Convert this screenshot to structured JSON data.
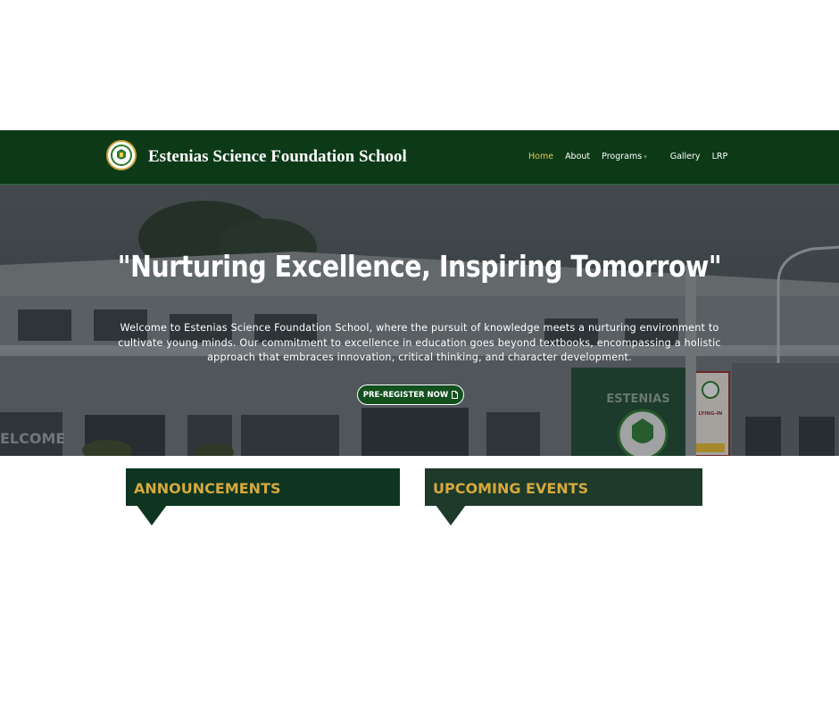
{
  "header": {
    "title": "Estenias Science Foundation School",
    "logo_icon": "school-crest-icon",
    "nav": {
      "home": "Home",
      "about": "About",
      "programs": "Programs",
      "gallery": "Gallery",
      "lrp": "LRP"
    }
  },
  "hero": {
    "title": "\"Nurturing Excellence, Inspiring Tomorrow\"",
    "text": "Welcome to Estenias Science Foundation School, where the pursuit of knowledge meets a nurturing environment to cultivate young minds. Our commitment to excellence in education goes beyond textbooks, encompassing a holistic approach that embraces innovation, critical thinking, and character development.",
    "cta_label": "PRE-REGISTER NOW",
    "cta_icon": "document-icon",
    "building_sign": "ESTENIAS",
    "clinic_sign": "ESTENIAS LYING-IN CLINIC"
  },
  "sections": {
    "announcements": "ANNOUNCEMENTS",
    "events": "UPCOMING EVENTS"
  },
  "colors": {
    "nav_bg": "#0c3a17",
    "active_link": "#e6c84a",
    "heading_gold": "#d6a93e",
    "cta_bg": "#13501e"
  }
}
